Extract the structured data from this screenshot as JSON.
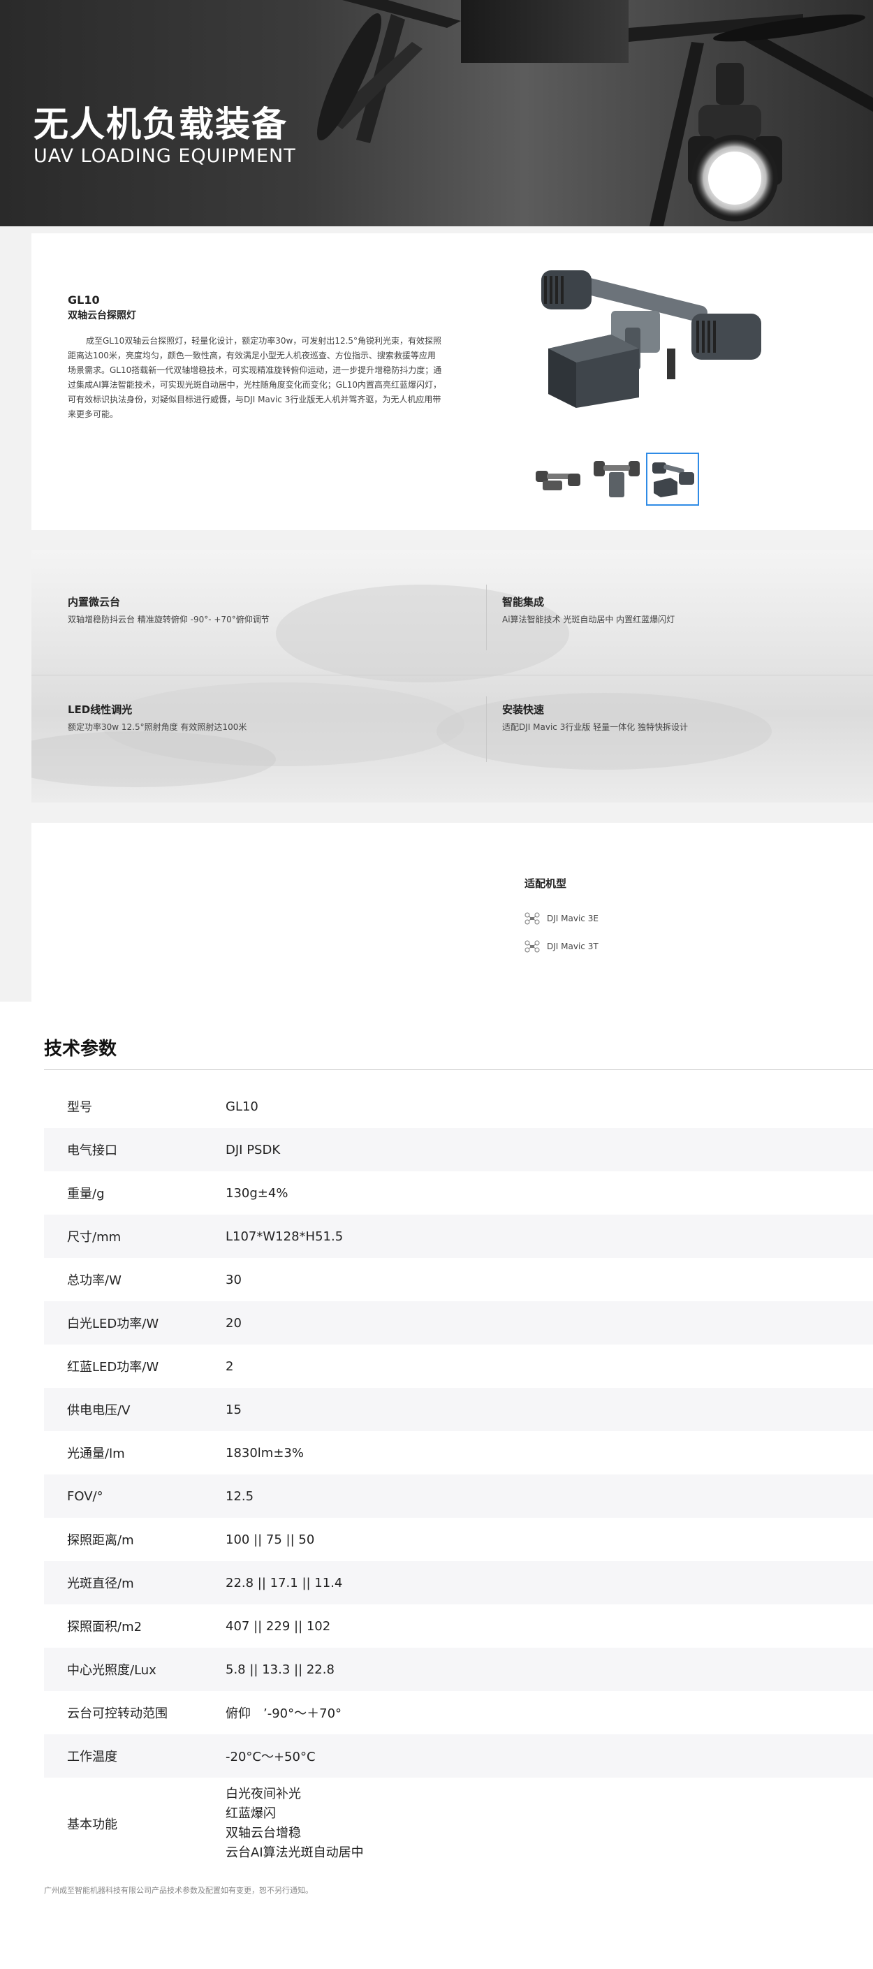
{
  "hero": {
    "title": "无人机负载装备",
    "subtitle": "UAV LOADING EQUIPMENT"
  },
  "product": {
    "model": "GL10",
    "name": "双轴云台探照灯",
    "description": "成至GL10双轴云台探照灯，轻量化设计，额定功率30w，可发射出12.5°角锐利光束，有效探照距离达100米，亮度均匀，颜色一致性高，有效满足小型无人机夜巡查、方位指示、搜索救援等应用场景需求。GL10搭载新一代双轴增稳技术，可实现精准旋转俯仰运动，进一步提升增稳防抖力度；通过集成AI算法智能技术，可实现光斑自动居中，光柱随角度变化而变化；GL10内置高亮红蓝爆闪灯，可有效标识执法身份，对疑似目标进行威慑，与DJI Mavic 3行业版无人机并驾齐驱，为无人机应用带来更多可能。",
    "thumbnails": [
      "thumb-front",
      "thumb-side",
      "thumb-angle"
    ],
    "active_thumbnail": 3
  },
  "features": [
    {
      "title": "内置微云台",
      "text": "双轴增稳防抖云台 精准旋转俯仰 -90°- +70°俯仰调节"
    },
    {
      "title": "智能集成",
      "text": "Ai算法智能技术 光斑自动居中 内置红蓝爆闪灯"
    },
    {
      "title": "LED线性调光",
      "text": "额定功率30w 12.5°照射角度 有效照射达100米"
    },
    {
      "title": "安装快速",
      "text": "适配DJI Mavic 3行业版 轻量一体化 独特快拆设计"
    }
  ],
  "compatible": {
    "title": "适配机型",
    "items": [
      "DJI Mavic 3E",
      "DJI Mavic 3T"
    ],
    "icon": "drone-icon"
  },
  "specs": {
    "title": "技术参数",
    "rows": [
      {
        "k": "型号",
        "v": "GL10"
      },
      {
        "k": "电气接口",
        "v": "DJI PSDK"
      },
      {
        "k": "重量/g",
        "v": "130g±4%"
      },
      {
        "k": "尺寸/mm",
        "v": "L107*W128*H51.5"
      },
      {
        "k": "总功率/W",
        "v": "30"
      },
      {
        "k": "白光LED功率/W",
        "v": "20"
      },
      {
        "k": "红蓝LED功率/W",
        "v": "2"
      },
      {
        "k": "供电电压/V",
        "v": "15"
      },
      {
        "k": "光通量/lm",
        "v": "1830lm±3%"
      },
      {
        "k": "FOV/°",
        "v": "12.5"
      },
      {
        "k": "探照距离/m",
        "v": "100 || 75 || 50"
      },
      {
        "k": "光斑直径/m",
        "v": "22.8 || 17.1 || 11.4"
      },
      {
        "k": "探照面积/m2",
        "v": "407 || 229 || 102"
      },
      {
        "k": "中心光照度/Lux",
        "v": "5.8 || 13.3 || 22.8"
      },
      {
        "k": "云台可控转动范围",
        "v": "俯仰　’-90°～＋70°"
      },
      {
        "k": "工作温度",
        "v": "-20°C～+50°C"
      }
    ],
    "functions_label": "基本功能",
    "functions": [
      "白光夜间补光",
      "红蓝爆闪",
      "双轴云台增稳",
      "云台AI算法光斑自动居中"
    ]
  },
  "footnote": "广州成至智能机器科技有限公司产品技术参数及配置如有变更，恕不另行通知。"
}
